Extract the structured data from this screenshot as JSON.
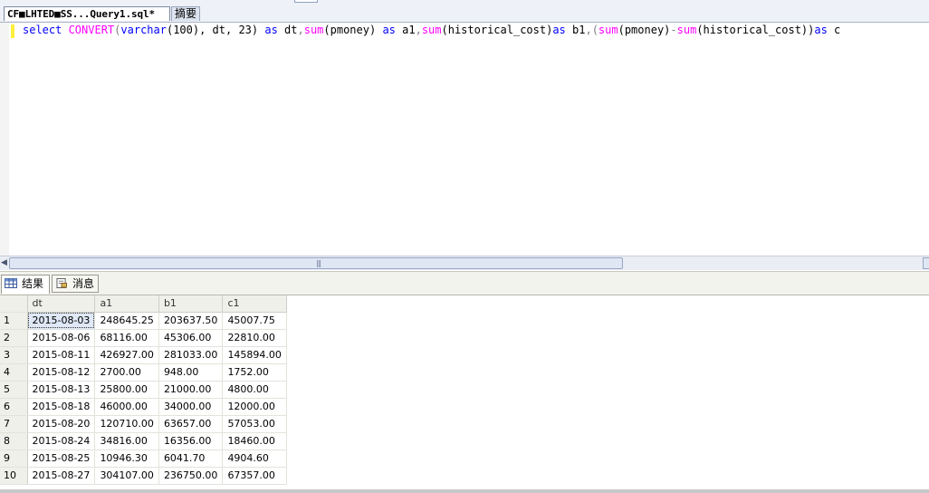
{
  "editor_tabs": [
    {
      "label": "CF■LHTED■SS...Query1.sql*",
      "active": true
    },
    {
      "label": "摘要",
      "active": false
    }
  ],
  "query": {
    "t1": "select ",
    "t2": "CONVERT",
    "t3": "(",
    "t4": "varchar",
    "t5": "(100), dt, 23) ",
    "t6": "as",
    "t7": " dt",
    "t8": ",",
    "t9": "sum",
    "t10": "(pmoney) ",
    "t11": "as",
    "t12": " a1",
    "t13": ",",
    "t14": "sum",
    "t15": "(historical_cost)",
    "t16": "as",
    "t17": " b1",
    "t18": ",(",
    "t19": "sum",
    "t20": "(pmoney)",
    "t21": "-",
    "t22": "sum",
    "t23": "(historical_cost))",
    "t24": "as",
    "t25": " c"
  },
  "results_tabs": [
    {
      "label": "结果",
      "icon": "grid-icon",
      "active": true
    },
    {
      "label": "消息",
      "icon": "message-icon",
      "active": false
    }
  ],
  "grid": {
    "columns": [
      "dt",
      "a1",
      "b1",
      "c1"
    ],
    "rows": [
      {
        "n": "1",
        "dt": "2015-08-03",
        "a1": "248645.25",
        "b1": "203637.50",
        "c1": "45007.75"
      },
      {
        "n": "2",
        "dt": "2015-08-06",
        "a1": "68116.00",
        "b1": "45306.00",
        "c1": "22810.00"
      },
      {
        "n": "3",
        "dt": "2015-08-11",
        "a1": "426927.00",
        "b1": "281033.00",
        "c1": "145894.00"
      },
      {
        "n": "4",
        "dt": "2015-08-12",
        "a1": "2700.00",
        "b1": "948.00",
        "c1": "1752.00"
      },
      {
        "n": "5",
        "dt": "2015-08-13",
        "a1": "25800.00",
        "b1": "21000.00",
        "c1": "4800.00"
      },
      {
        "n": "6",
        "dt": "2015-08-18",
        "a1": "46000.00",
        "b1": "34000.00",
        "c1": "12000.00"
      },
      {
        "n": "7",
        "dt": "2015-08-20",
        "a1": "120710.00",
        "b1": "63657.00",
        "c1": "57053.00"
      },
      {
        "n": "8",
        "dt": "2015-08-24",
        "a1": "34816.00",
        "b1": "16356.00",
        "c1": "18460.00"
      },
      {
        "n": "9",
        "dt": "2015-08-25",
        "a1": "10946.30",
        "b1": "6041.70",
        "c1": "4904.60"
      },
      {
        "n": "10",
        "dt": "2015-08-27",
        "a1": "304107.00",
        "b1": "236750.00",
        "c1": "67357.00"
      }
    ]
  }
}
